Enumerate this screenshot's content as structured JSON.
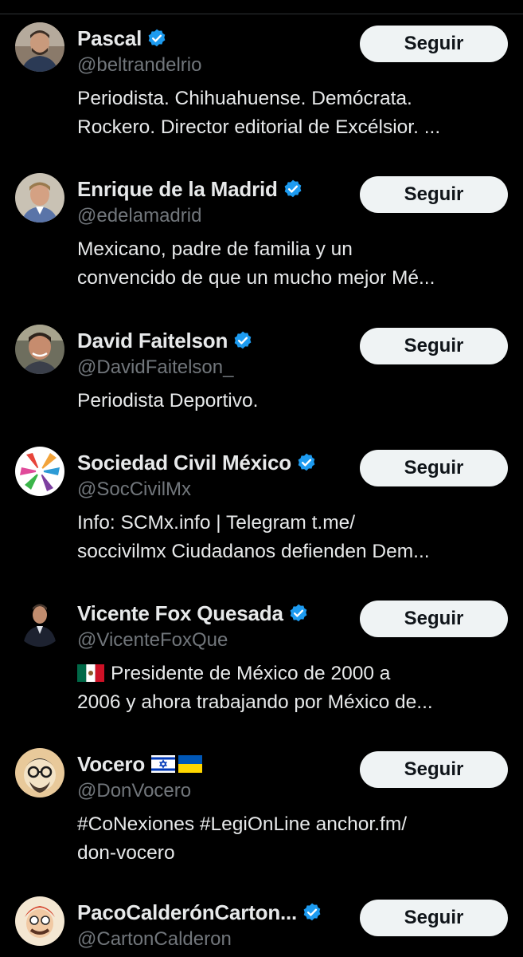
{
  "accounts": [
    {
      "name": "Pascal",
      "handle": "@beltrandelrio",
      "verified": true,
      "bio_lines": [
        "Periodista. Chihuahuense. Demócrata.",
        "Rockero. Director editorial de Excélsior. ..."
      ],
      "button_label": "Seguir"
    },
    {
      "name": "Enrique de la Madrid",
      "handle": "@edelamadrid",
      "verified": true,
      "bio_lines": [
        "Mexicano, padre de familia y un",
        "convencido de que un mucho mejor Mé..."
      ],
      "button_label": "Seguir"
    },
    {
      "name": "David Faitelson",
      "handle": "@DavidFaitelson_",
      "verified": true,
      "bio_lines": [
        "Periodista Deportivo."
      ],
      "button_label": "Seguir"
    },
    {
      "name": "Sociedad Civil México",
      "handle": "@SocCivilMx",
      "verified": true,
      "bio_lines": [
        "Info: SCMx.info | Telegram t.me/",
        "soccivilmx Ciudadanos defienden Dem..."
      ],
      "button_label": "Seguir"
    },
    {
      "name": "Vicente Fox Quesada",
      "handle": "@VicenteFoxQue",
      "verified": true,
      "bio_lines": [
        "Presidente de México de 2000 a",
        "2006 y ahora trabajando por México de..."
      ],
      "button_label": "Seguir"
    },
    {
      "name": "Vocero",
      "handle": "@DonVocero",
      "verified": false,
      "flags": [
        "israel-flag",
        "ukraine-flag"
      ],
      "bio_lines": [
        "#CoNexiones #LegiOnLine anchor.fm/",
        "don-vocero"
      ],
      "button_label": "Seguir"
    },
    {
      "name": "PacoCalderónCarton...",
      "handle": "@CartonCalderon",
      "verified": true,
      "bio_lines": [],
      "button_label": "Seguir"
    }
  ],
  "colors": {
    "background": "#000000",
    "primary_text": "#e7e9ea",
    "secondary_text": "#71767b",
    "verified_badge": "#1d9bf0",
    "button_bg": "#eff3f4",
    "button_text": "#0f1419"
  }
}
